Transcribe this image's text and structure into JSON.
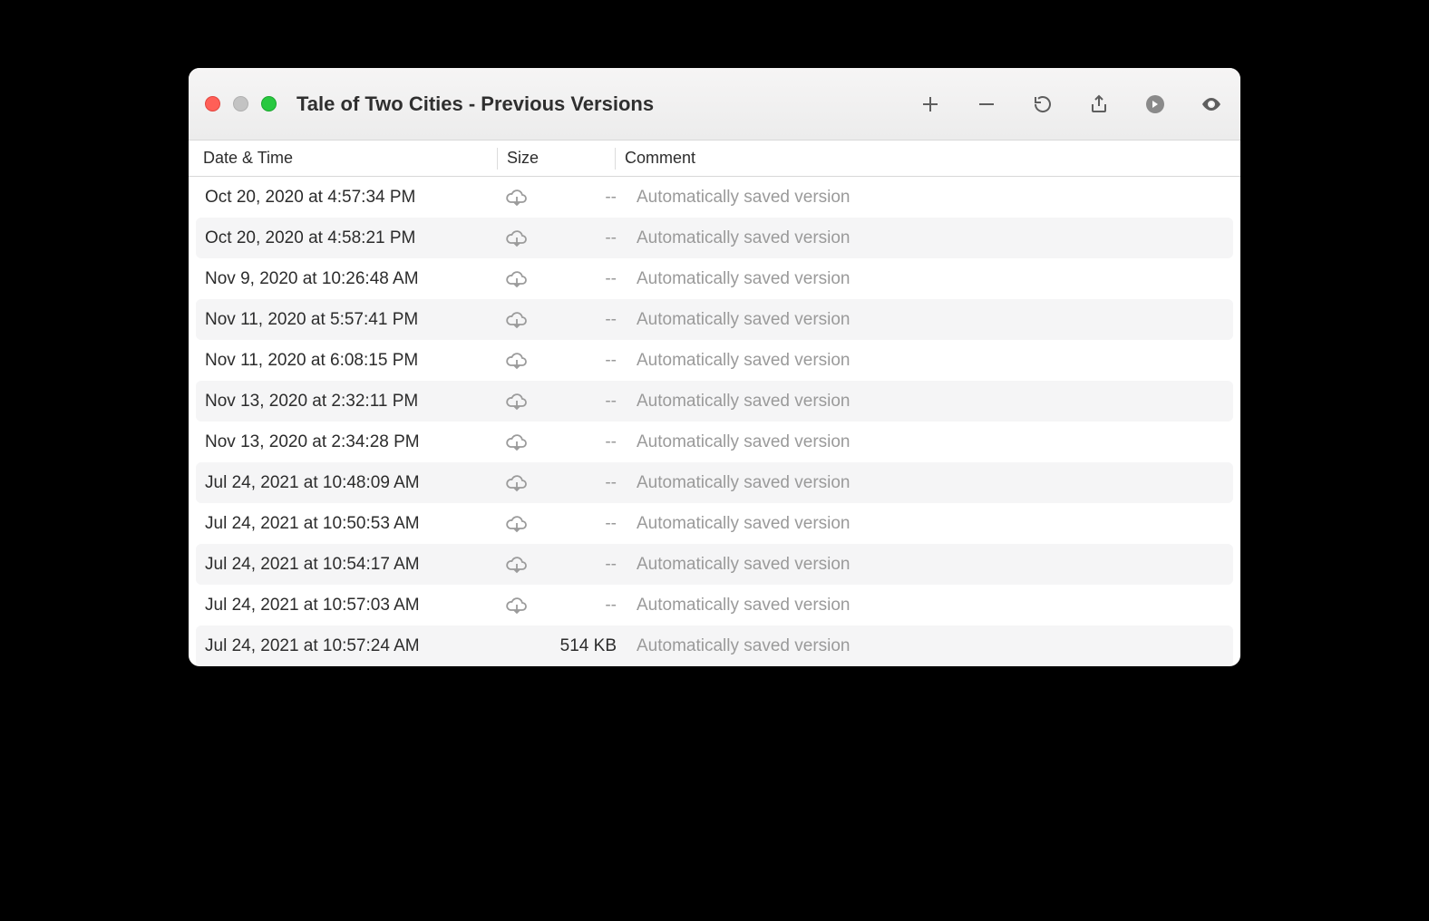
{
  "window": {
    "title": "Tale of Two Cities - Previous Versions"
  },
  "columns": {
    "date": "Date & Time",
    "size": "Size",
    "comment": "Comment"
  },
  "size_placeholder": "--",
  "versions": [
    {
      "date": "Oct 20, 2020 at 4:57:34 PM",
      "cloud": true,
      "size": "",
      "comment": "Automatically saved version"
    },
    {
      "date": "Oct 20, 2020 at 4:58:21 PM",
      "cloud": true,
      "size": "",
      "comment": "Automatically saved version"
    },
    {
      "date": "Nov 9, 2020 at 10:26:48 AM",
      "cloud": true,
      "size": "",
      "comment": "Automatically saved version"
    },
    {
      "date": "Nov 11, 2020 at 5:57:41 PM",
      "cloud": true,
      "size": "",
      "comment": "Automatically saved version"
    },
    {
      "date": "Nov 11, 2020 at 6:08:15 PM",
      "cloud": true,
      "size": "",
      "comment": "Automatically saved version"
    },
    {
      "date": "Nov 13, 2020 at 2:32:11 PM",
      "cloud": true,
      "size": "",
      "comment": "Automatically saved version"
    },
    {
      "date": "Nov 13, 2020 at 2:34:28 PM",
      "cloud": true,
      "size": "",
      "comment": "Automatically saved version"
    },
    {
      "date": "Jul 24, 2021 at 10:48:09 AM",
      "cloud": true,
      "size": "",
      "comment": "Automatically saved version"
    },
    {
      "date": "Jul 24, 2021 at 10:50:53 AM",
      "cloud": true,
      "size": "",
      "comment": "Automatically saved version"
    },
    {
      "date": "Jul 24, 2021 at 10:54:17 AM",
      "cloud": true,
      "size": "",
      "comment": "Automatically saved version"
    },
    {
      "date": "Jul 24, 2021 at 10:57:03 AM",
      "cloud": true,
      "size": "",
      "comment": "Automatically saved version"
    },
    {
      "date": "Jul 24, 2021 at 10:57:24 AM",
      "cloud": false,
      "size": "514 KB",
      "comment": "Automatically saved version"
    }
  ]
}
